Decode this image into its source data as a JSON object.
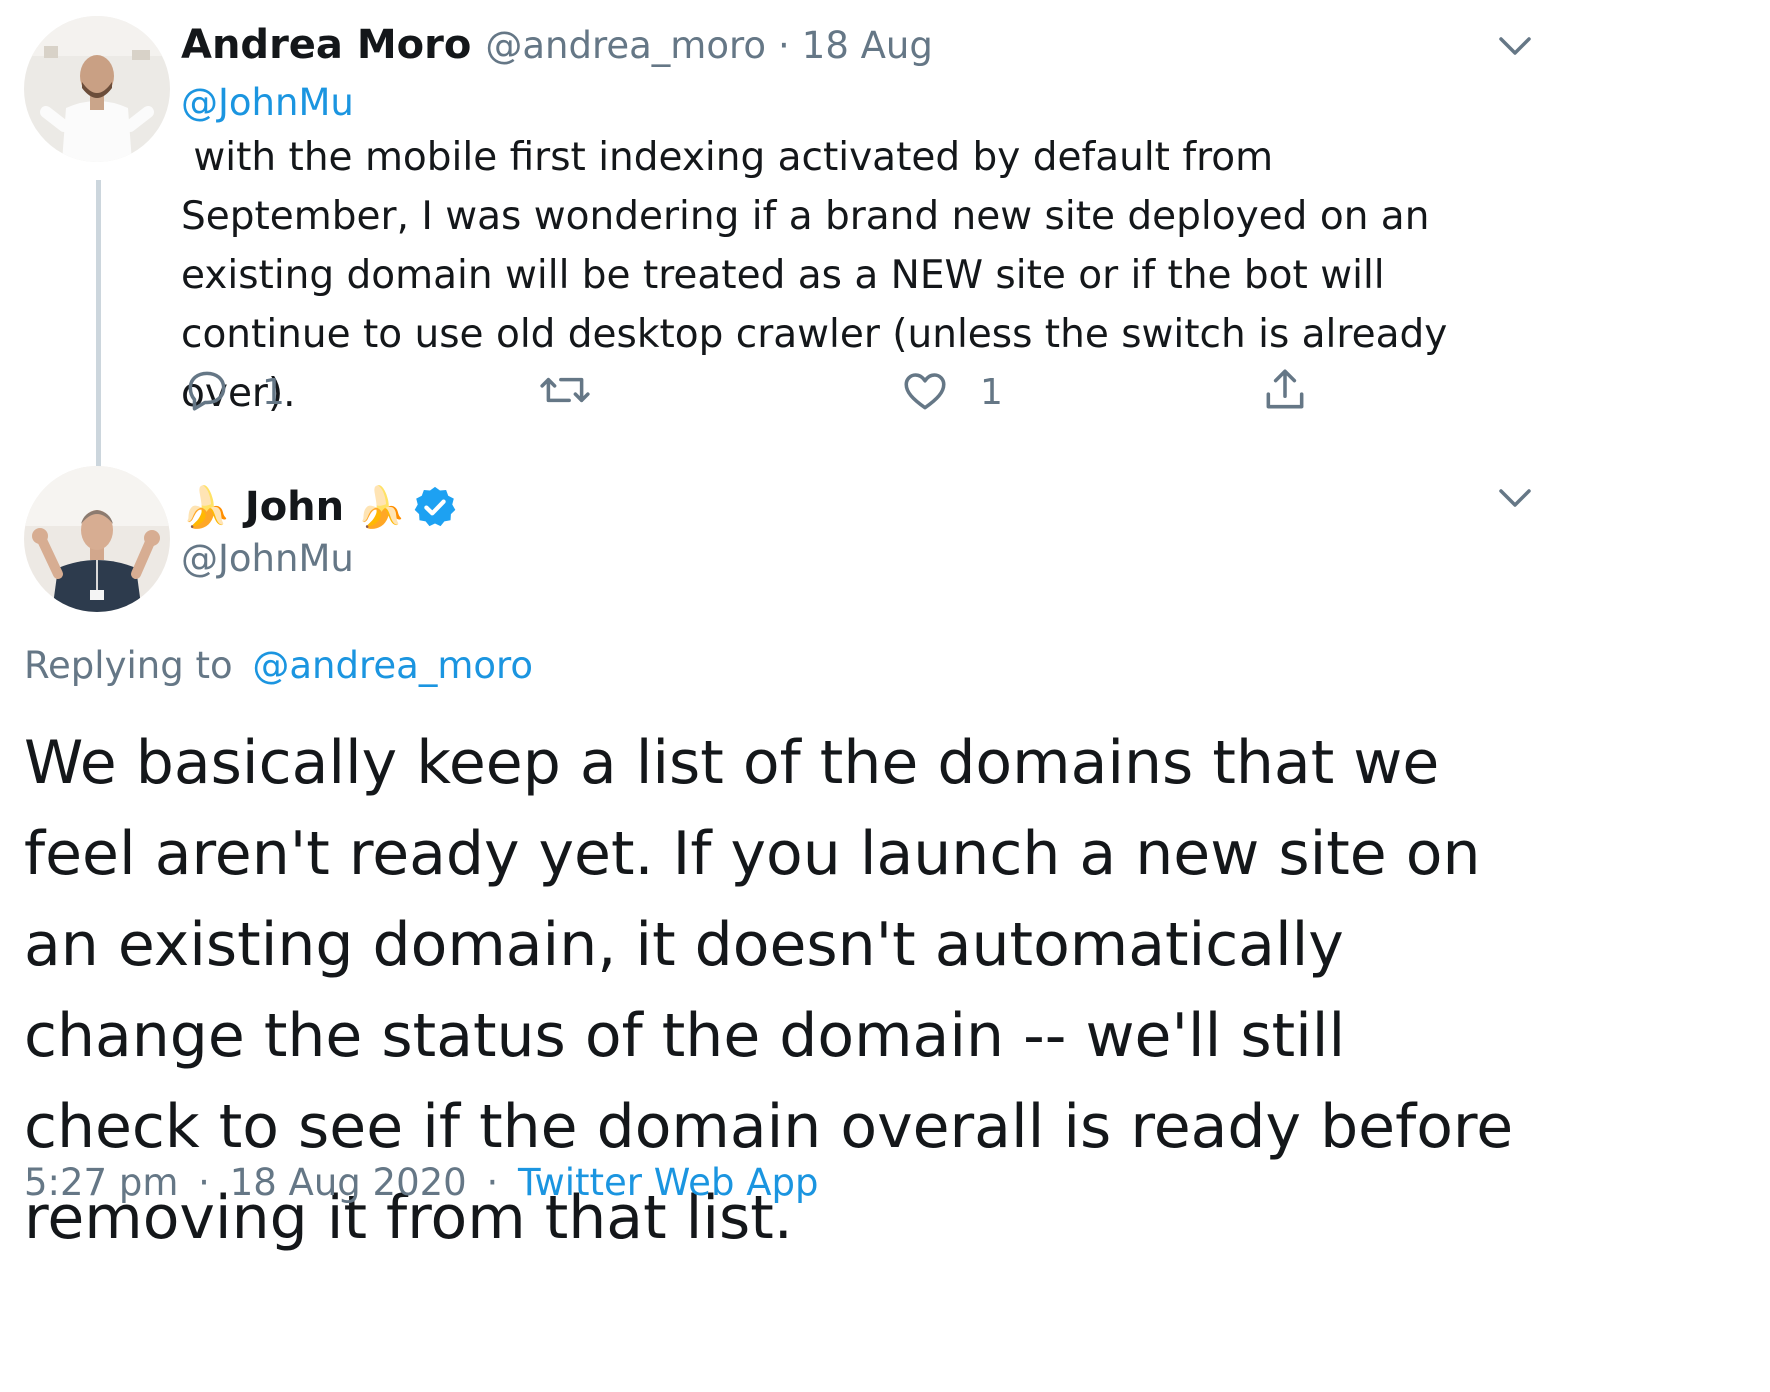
{
  "parent_tweet": {
    "author_name": "Andrea Moro",
    "author_handle": "@andrea_moro",
    "separator": "·",
    "date": "18 Aug",
    "mention": "@JohnMu",
    "text": " with the mobile first indexing activated by default from September, I was wondering if a brand new site deployed on an existing domain will be treated as a NEW site or if the bot will continue to use old desktop crawler (unless the switch is already over).",
    "actions": {
      "reply_count": "1",
      "retweet_count": "",
      "like_count": "1"
    }
  },
  "main_tweet": {
    "name_emoji": "🍌",
    "author_name": "John",
    "verified": true,
    "author_handle": "@JohnMu",
    "replying_to_label": "Replying to",
    "replying_to_handle": "@andrea_moro",
    "text": "We basically keep a list of the domains that we feel aren't ready yet. If you launch a new site on an existing domain, it doesn't automatically change the status of the domain -- we'll still check to see if the domain overall is ready before removing it from that list.",
    "time": "5:27 pm",
    "separator": "·",
    "date": "18 Aug 2020",
    "source": "Twitter Web App"
  },
  "icons": {
    "caret": "chevron-down-icon",
    "reply": "reply-icon",
    "retweet": "retweet-icon",
    "like": "heart-icon",
    "share": "share-icon",
    "verified": "verified-badge-icon"
  },
  "colors": {
    "text": "#14171a",
    "muted": "#657786",
    "link": "#1b95e0",
    "verified": "#1da1f2",
    "thread_line": "#ccd6dd"
  }
}
